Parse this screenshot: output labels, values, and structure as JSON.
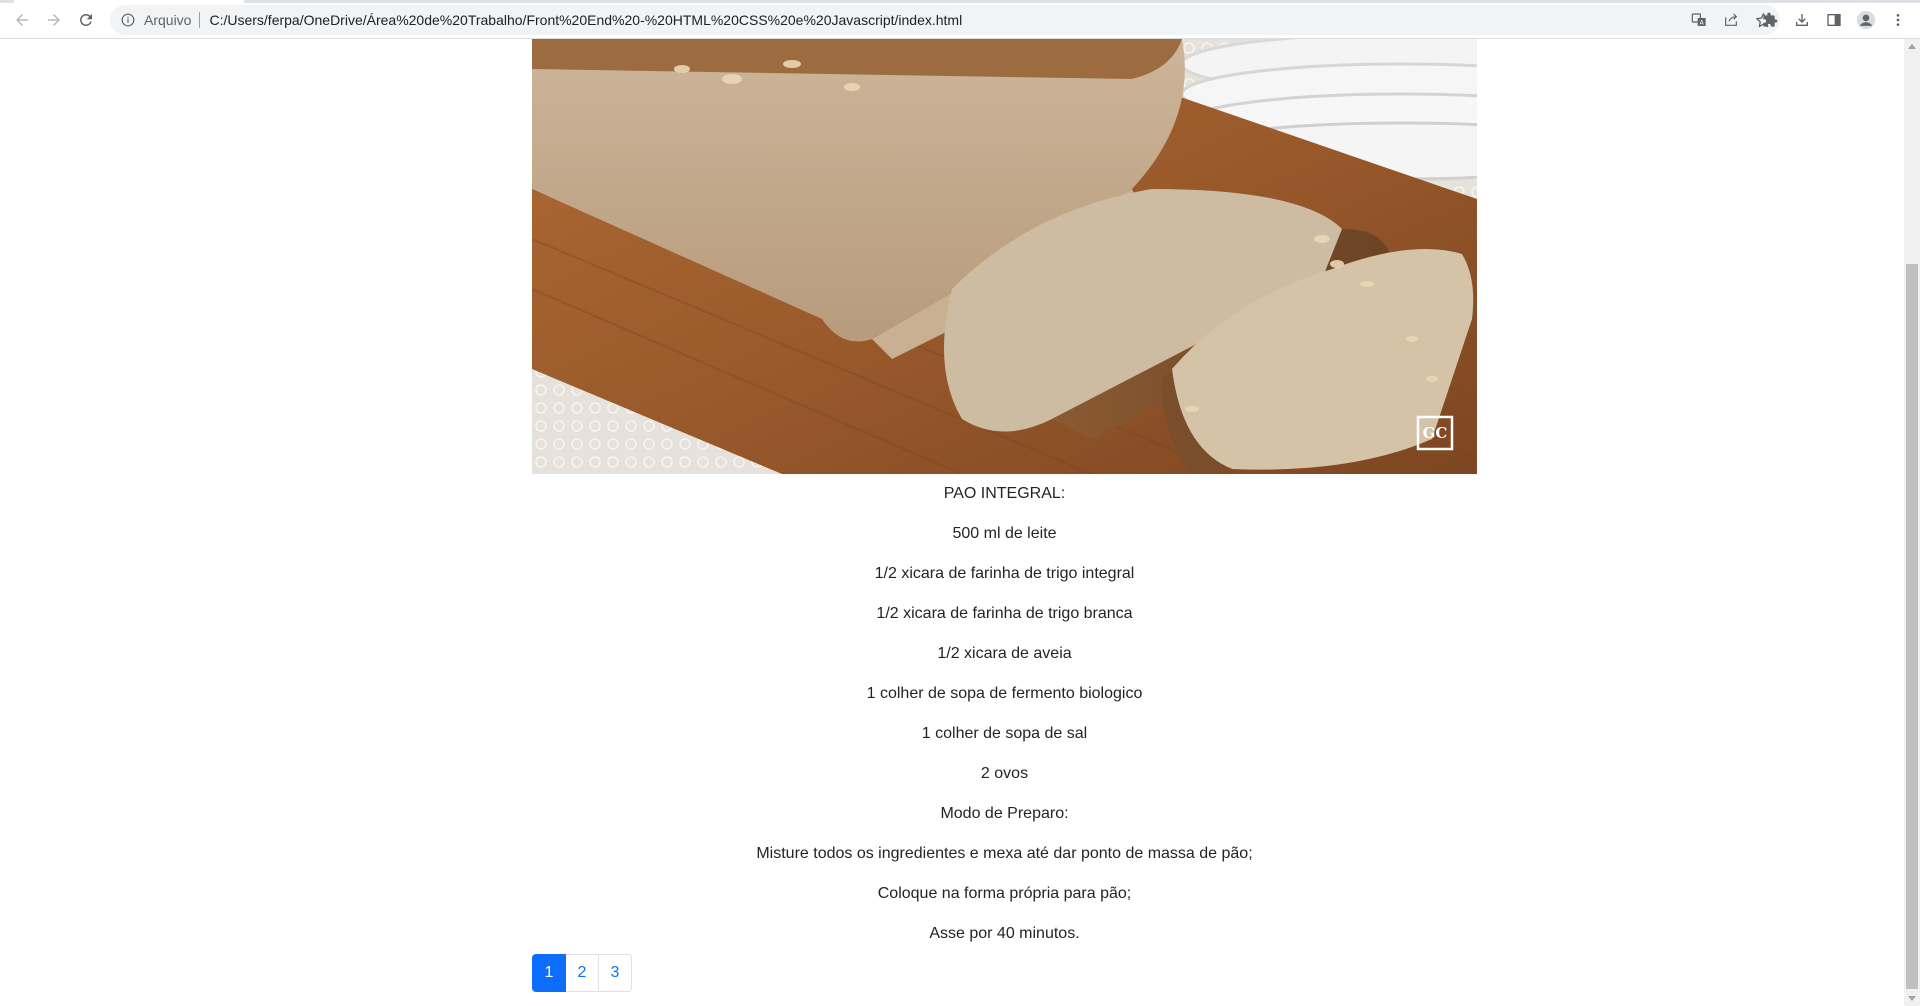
{
  "browser": {
    "scheme_label": "Arquivo",
    "url": "C:/Users/ferpa/OneDrive/Área%20de%20Trabalho/Front%20End%20-%20HTML%20CSS%20e%20Javascript/index.html"
  },
  "hero_image": {
    "alt": "pão integral fatiado",
    "watermark": "GC"
  },
  "recipe": {
    "lines": [
      "PAO INTEGRAL:",
      "500 ml de leite",
      "1/2 xicara de farinha de trigo integral",
      "1/2 xicara de farinha de trigo branca",
      "1/2 xicara de aveia",
      "1 colher de sopa de fermento biologico",
      "1 colher de sopa de sal",
      "2 ovos",
      "Modo de Preparo:",
      "Misture todos os ingredientes e mexa até dar ponto de massa de pão;",
      "Coloque na forma própria para pão;",
      "Asse por 40 minutos."
    ]
  },
  "pagination": {
    "pages": [
      "1",
      "2",
      "3"
    ],
    "active": "1"
  },
  "colors": {
    "accent": "#0d6efd",
    "text": "#212529"
  }
}
